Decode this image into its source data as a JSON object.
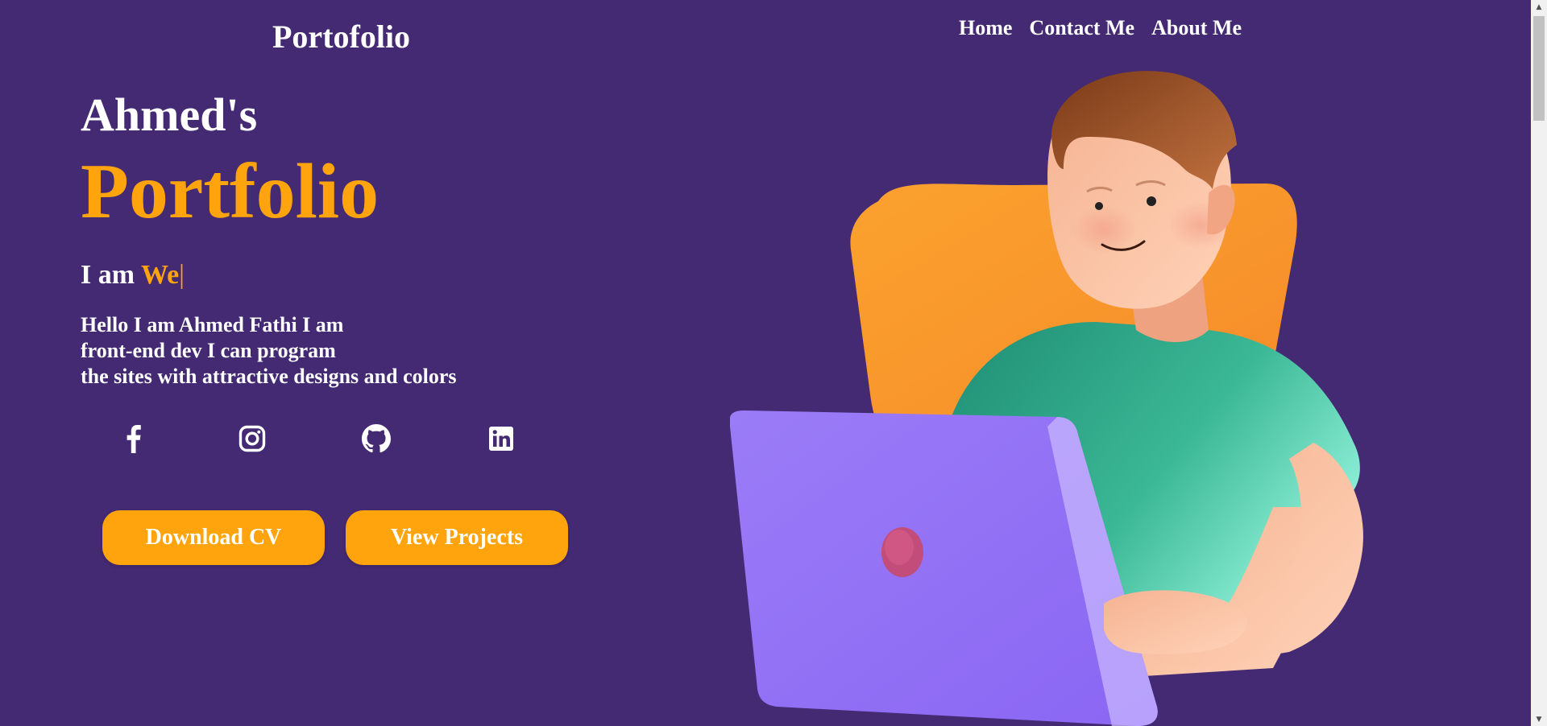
{
  "header": {
    "brand": "Portofolio",
    "nav": [
      "Home",
      "Contact Me",
      "About Me"
    ]
  },
  "hero": {
    "owner": "Ahmed's",
    "title": "Portfolio",
    "iam_prefix": "I am ",
    "iam_typed": "We",
    "iam_caret": "|",
    "bio": [
      "Hello I am Ahmed Fathi I am",
      "front-end dev I can program",
      "the sites with attractive designs and colors"
    ],
    "socials": [
      "facebook-icon",
      "instagram-icon",
      "github-icon",
      "linkedin-icon"
    ],
    "buttons": {
      "download": "Download CV",
      "projects": "View Projects"
    }
  },
  "colors": {
    "background": "#432a73",
    "accent": "#ffa40c",
    "text": "#ffffff"
  }
}
